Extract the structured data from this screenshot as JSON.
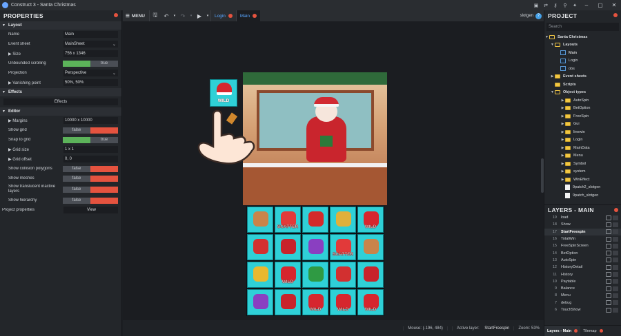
{
  "window": {
    "title": "Construct 3 - Santa Christmas"
  },
  "properties": {
    "header": "PROPERTIES",
    "sections": {
      "layout": "Layout",
      "effects": "Effects",
      "editor": "Editor"
    },
    "layout_props": {
      "name_label": "Name",
      "name_value": "Main",
      "event_sheet_label": "Event sheet",
      "event_sheet_value": "MainSheet",
      "size_label": "Size",
      "size_value": "756 x 1346",
      "unbounded_label": "Unbounded scrolling",
      "unbounded_false": "",
      "unbounded_true": "true",
      "projection_label": "Projection",
      "projection_value": "Perspective",
      "vanishing_label": "Vanishing point",
      "vanishing_value": "50%, 50%"
    },
    "effects_button": "Effects",
    "editor_props": {
      "margins_label": "Margins",
      "margins_value": "10000 x 10000",
      "show_grid_label": "Show grid",
      "show_grid_false": "false",
      "snap_label": "Snap to grid",
      "snap_true": "true",
      "grid_size_label": "Grid size",
      "grid_size_value": "1 x 1",
      "grid_offset_label": "Grid offset",
      "grid_offset_value": "0, 0",
      "collision_label": "Show collision polygons",
      "collision_false": "false",
      "meshes_label": "Show meshes",
      "meshes_false": "false",
      "translucent_label": "Show translucent inactive layers",
      "translucent_false": "false",
      "hierarchy_label": "Show hierarchy",
      "hierarchy_false": "false"
    },
    "project_props_label": "Project properties",
    "project_props_button": "View"
  },
  "toolbar": {
    "menu_label": "MENU",
    "tabs": [
      "Login",
      "Main"
    ],
    "user": "slotgen",
    "help": "?"
  },
  "canvas": {
    "grid_symbols": [
      [
        "gingerbread-house",
        "santa-scatter",
        "mitten",
        "bells-wild-red",
        "santa-hat-wild"
      ],
      [
        "mug",
        "santa-hat",
        "gift-purple",
        "santa-scatter",
        "gingerbread-house"
      ],
      [
        "bells-gold",
        "santa-hat-wild",
        "christmas-tree",
        "mug",
        "santa-hat"
      ],
      [
        "gift-purple",
        "santa-hat",
        "santa-hat-wild",
        "santa-hat-wild",
        "santa-hat-wild"
      ]
    ],
    "grid_labels": [
      [
        "",
        "SCATTER",
        "",
        "",
        "WILD"
      ],
      [
        "",
        "",
        "",
        "SCATTER",
        ""
      ],
      [
        "",
        "WILD",
        "",
        "",
        ""
      ],
      [
        "",
        "",
        "WILD",
        "WILD",
        "WILD"
      ]
    ],
    "wild_card_label": "WILD"
  },
  "statusbar": {
    "mouse_label": "Mouse: (-196, 484)",
    "active_layer_prefix": "Active layer:",
    "active_layer": "StartFreespin",
    "zoom": "Zoom: 53%"
  },
  "project": {
    "header": "PROJECT",
    "search_placeholder": "Search",
    "root": "Santa Christmas",
    "layouts_folder": "Layouts",
    "layouts": [
      "Main",
      "Login",
      "obs"
    ],
    "event_sheets": "Event sheets",
    "scripts": "Scripts",
    "object_types": "Object types",
    "object_folders": [
      "AutoSpin",
      "BetOption",
      "FreeSpin",
      "Gui",
      "linewin",
      "Login",
      "MainData",
      "Menu",
      "Symbol",
      "system",
      "WinEffect"
    ],
    "object_files": [
      "9patch2_slotgen",
      "9patch_slotgen"
    ]
  },
  "layers": {
    "header": "LAYERS - MAIN",
    "rows": [
      {
        "num": "19",
        "name": "load"
      },
      {
        "num": "18",
        "name": "Show"
      },
      {
        "num": "17",
        "name": "StartFreespin"
      },
      {
        "num": "16",
        "name": "TotalWin"
      },
      {
        "num": "15",
        "name": "FreeSpinScreen"
      },
      {
        "num": "14",
        "name": "BetOption"
      },
      {
        "num": "13",
        "name": "AutoSpin"
      },
      {
        "num": "12",
        "name": "HistoryDetail"
      },
      {
        "num": "11",
        "name": "History"
      },
      {
        "num": "10",
        "name": "Paytable"
      },
      {
        "num": "9",
        "name": "Balance"
      },
      {
        "num": "8",
        "name": "Menu"
      },
      {
        "num": "7",
        "name": "debug"
      },
      {
        "num": "6",
        "name": "TouchShow"
      }
    ],
    "selected_row": "17",
    "bottom_tabs": [
      "Layers - Main",
      "Tilemap"
    ]
  },
  "colors": {
    "accent": "#58a6ff",
    "close_dot": "#e5533f",
    "toggle_green": "#5cb35a",
    "toggle_red": "#e5533f",
    "reel_bg": "#2fd0d7"
  }
}
